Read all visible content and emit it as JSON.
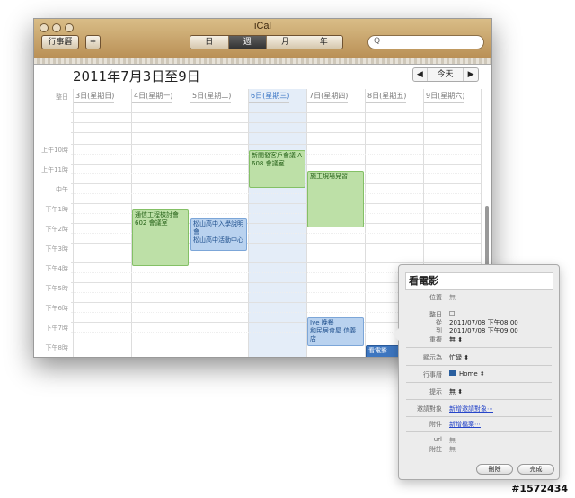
{
  "app": {
    "title": "iCal"
  },
  "toolbar": {
    "calendars_label": "行事曆",
    "add_label": "+",
    "views": [
      "日",
      "週",
      "月",
      "年"
    ],
    "active_view": "週",
    "today_label": "今天",
    "prev_label": "◀",
    "next_label": "▶",
    "search_placeholder": "Q"
  },
  "header": {
    "date_range": "2011年7月3日至9日"
  },
  "days": [
    {
      "label": "3日(星期日)"
    },
    {
      "label": "4日(星期一)"
    },
    {
      "label": "5日(星期二)"
    },
    {
      "label": "6日(星期三)"
    },
    {
      "label": "7日(星期四)"
    },
    {
      "label": "8日(星期五)"
    },
    {
      "label": "9日(星期六)"
    }
  ],
  "allday_label": "整日",
  "time_labels": [
    "上午10時",
    "上午11時",
    "中午",
    "下午1時",
    "下午2時",
    "下午3時",
    "下午4時",
    "下午5時",
    "下午6時",
    "下午7時",
    "下午8時"
  ],
  "events": [
    {
      "title": "新開發客戶會議 A",
      "location": "608 會議室",
      "color": "green"
    },
    {
      "title": "施工現場見習",
      "location": "",
      "color": "green"
    },
    {
      "title": "通信工程檢討會",
      "location": "602 會議室",
      "color": "green"
    },
    {
      "title": "松山高中入學說明會",
      "location": "松山高中活動中心",
      "color": "blue"
    },
    {
      "title": "Ive 晚餐",
      "location": "和民居食屋 信義店",
      "color": "blue"
    },
    {
      "title": "看電影",
      "location": "",
      "color": "bluesel"
    }
  ],
  "popup": {
    "title": "看電影",
    "fields": [
      {
        "label": "位置",
        "value": "無"
      },
      {
        "label": "整日",
        "value": "☐"
      },
      {
        "label": "從",
        "value": "2011/07/08 下午08:00"
      },
      {
        "label": "到",
        "value": "2011/07/08 下午09:00"
      },
      {
        "label": "重複",
        "value": "無 ⬍"
      },
      {
        "label": "顯示為",
        "value": "忙碌 ⬍"
      },
      {
        "label": "行事曆",
        "value": "Home ⬍"
      },
      {
        "label": "提示",
        "value": "無 ⬍"
      },
      {
        "label": "邀請對象",
        "value": "新增邀請對象⋯"
      },
      {
        "label": "附件",
        "value": "新增檔案⋯"
      },
      {
        "label": "url",
        "value": "無"
      },
      {
        "label": "附註",
        "value": "無"
      }
    ],
    "delete_label": "刪除",
    "done_label": "完成"
  },
  "watermark": "#1572434",
  "colors": {
    "titlebar": "#c9a66c",
    "green": "#bde0a7",
    "blue": "#b9d2ef",
    "selected": "#3d76c0"
  }
}
